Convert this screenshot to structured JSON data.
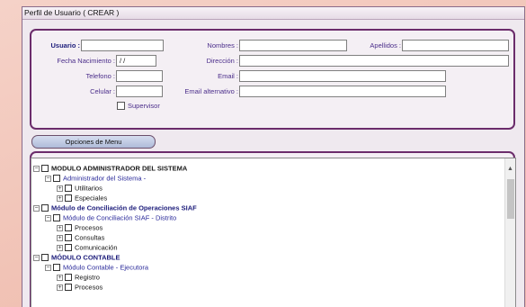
{
  "window": {
    "title": "Perfil de Usuario ( CREAR )"
  },
  "form": {
    "usuario_label": "Usuario :",
    "nombres_label": "Nombres :",
    "apellidos_label": "Apellidos :",
    "fecha_label": "Fecha Nacimiento :",
    "fecha_value": "/ /",
    "direccion_label": "Dirección :",
    "telefono_label": "Telefono :",
    "email_label": "Email :",
    "celular_label": "Celular :",
    "email_alt_label": "Email alternativo :",
    "supervisor_label": "Supervisor"
  },
  "menu": {
    "tab_label": "Opciones de Menu",
    "tree": [
      {
        "label": "MODULO ADMINISTRADOR DEL SISTEMA",
        "level": 0,
        "expander": "minus"
      },
      {
        "label": "Administrador del Sistema -",
        "level": 1,
        "expander": "minus"
      },
      {
        "label": "Utilitarios",
        "level": 2,
        "expander": "plus"
      },
      {
        "label": "Especiales",
        "level": 2,
        "expander": "plus"
      },
      {
        "label": "Módulo de Conciliación de Operaciones SIAF",
        "level": 0,
        "expander": "minus"
      },
      {
        "label": "Módulo de Conciliación SIAF - Distrito",
        "level": 1,
        "expander": "minus"
      },
      {
        "label": "Procesos",
        "level": 2,
        "expander": "plus"
      },
      {
        "label": "Consultas",
        "level": 2,
        "expander": "plus"
      },
      {
        "label": "Comunicación",
        "level": 2,
        "expander": "plus"
      },
      {
        "label": "MÓDULO CONTABLE",
        "level": 0,
        "expander": "minus"
      },
      {
        "label": "Módulo Contable - Ejecutora",
        "level": 1,
        "expander": "minus"
      },
      {
        "label": "Registro",
        "level": 2,
        "expander": "plus"
      },
      {
        "label": "Procesos",
        "level": 2,
        "expander": "plus"
      }
    ]
  },
  "colors": {
    "panel_border": "#6b2c6b",
    "label_blue": "#4a2d8a",
    "tab_bg": "#aebbd9"
  }
}
